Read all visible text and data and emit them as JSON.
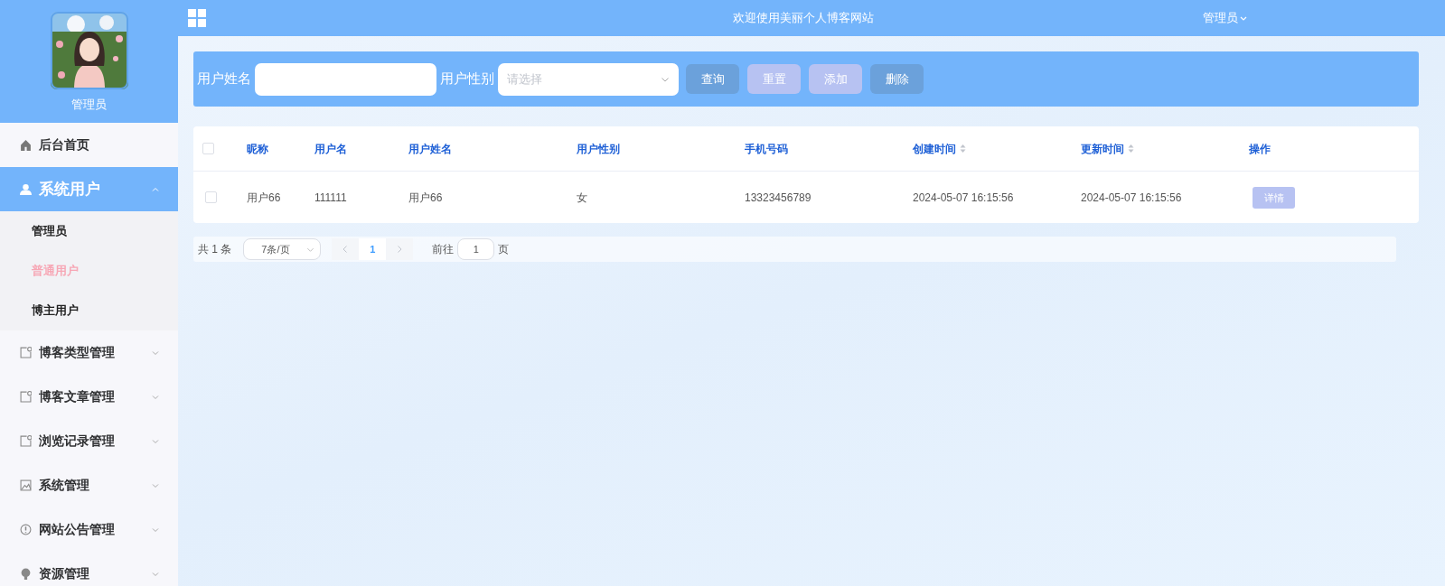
{
  "sidebar": {
    "user_name": "管理员",
    "items": [
      {
        "label": "后台首页",
        "kind": "link"
      },
      {
        "label": "系统用户",
        "kind": "submenu",
        "expanded": true,
        "children": [
          {
            "label": "管理员",
            "selected": false
          },
          {
            "label": "普通用户",
            "selected": true
          },
          {
            "label": "博主用户",
            "selected": false
          }
        ]
      },
      {
        "label": "博客类型管理",
        "kind": "submenu",
        "expanded": false
      },
      {
        "label": "博客文章管理",
        "kind": "submenu",
        "expanded": false
      },
      {
        "label": "浏览记录管理",
        "kind": "submenu",
        "expanded": false
      },
      {
        "label": "系统管理",
        "kind": "submenu",
        "expanded": false
      },
      {
        "label": "网站公告管理",
        "kind": "submenu",
        "expanded": false
      },
      {
        "label": "资源管理",
        "kind": "submenu",
        "expanded": false
      }
    ]
  },
  "header": {
    "title": "欢迎使用美丽个人博客网站",
    "user_menu": "管理员"
  },
  "search": {
    "fields": [
      {
        "label": "用户姓名",
        "kind": "text"
      },
      {
        "label": "用户性别",
        "kind": "select",
        "placeholder": "请选择"
      }
    ],
    "buttons": [
      {
        "label": "查询",
        "kind": "primary"
      },
      {
        "label": "重置",
        "kind": "secondary"
      },
      {
        "label": "添加",
        "kind": "secondary"
      },
      {
        "label": "删除",
        "kind": "primary"
      }
    ]
  },
  "table": {
    "select_all": {
      "checked": false
    },
    "columns": [
      {
        "label": "昵称",
        "sortable": false
      },
      {
        "label": "用户名",
        "sortable": false
      },
      {
        "label": "用户姓名",
        "sortable": false
      },
      {
        "label": "用户性别",
        "sortable": false
      },
      {
        "label": "手机号码",
        "sortable": false
      },
      {
        "label": "创建时间",
        "sortable": true
      },
      {
        "label": "更新时间",
        "sortable": true
      },
      {
        "label": "操作",
        "sortable": false
      }
    ],
    "rows": [
      {
        "checked": false,
        "cells": [
          "用户66",
          "111111",
          "用户66",
          "女",
          "13323456789",
          "2024-05-07 16:15:56",
          "2024-05-07 16:15:56"
        ],
        "action": "详情"
      }
    ]
  },
  "pagination": {
    "total": "共 1 条",
    "page_size": "7条/页",
    "pages": [
      {
        "label": "1",
        "selected": true
      }
    ],
    "goto_label": "前往",
    "goto_value": "1",
    "goto_suffix": "页"
  }
}
